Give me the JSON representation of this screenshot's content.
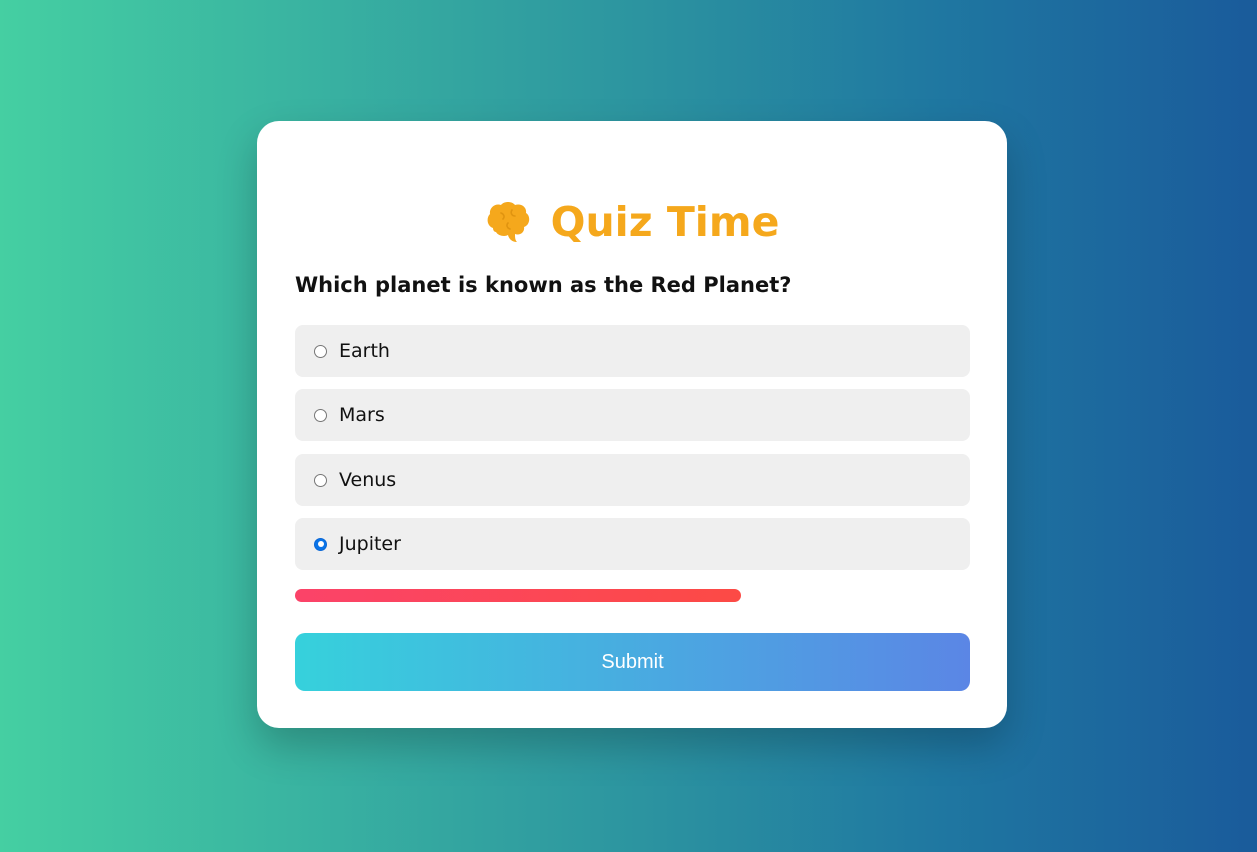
{
  "quiz": {
    "title": "Quiz Time",
    "title_icon": "brain-icon",
    "question": "Which planet is known as the Red Planet?",
    "options": [
      {
        "label": "Earth",
        "selected": false
      },
      {
        "label": "Mars",
        "selected": false
      },
      {
        "label": "Venus",
        "selected": false
      },
      {
        "label": "Jupiter",
        "selected": true
      }
    ],
    "progress_fraction": 0.66,
    "submit_label": "Submit"
  },
  "colors": {
    "title": "#f5a81c",
    "progress_start": "#fb4369",
    "progress_end": "#fc4a45",
    "button_start": "#36d1dc",
    "button_end": "#5b86e5",
    "background_start": "#45cfa2",
    "background_end": "#1a5b9b"
  }
}
